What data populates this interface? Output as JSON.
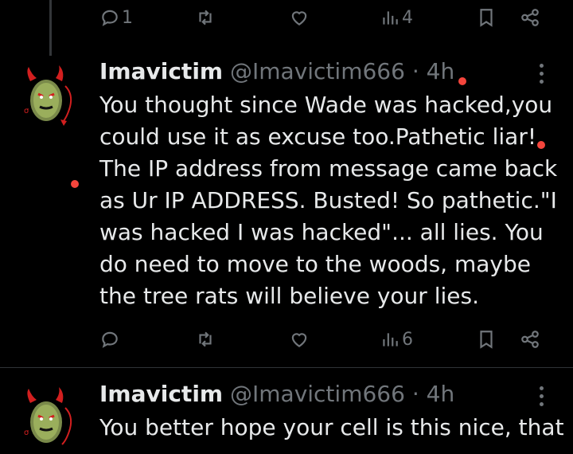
{
  "top_actions": {
    "reply_count": "1",
    "views_count": "4"
  },
  "tweet1": {
    "display_name": "Imavictim",
    "handle": "@Imavictim666",
    "separator": "·",
    "time": "4h",
    "text": "You thought since Wade was hacked,you could use it as excuse too.Pathetic liar! The IP address from message came back as Ur IP ADDRESS. Busted! So pathetic.\"I was hacked I was hacked\"... all lies. You do need to move to the woods, maybe the tree rats will believe your lies.",
    "actions": {
      "views_count": "6"
    }
  },
  "tweet2": {
    "display_name": "Imavictim",
    "handle": "@Imavictim666",
    "separator": "·",
    "time": "4h",
    "text": "You better hope your cell is this nice, that"
  },
  "colors": {
    "background": "#000000",
    "text": "#e7e9ea",
    "muted": "#71767b",
    "divider": "#2f3336",
    "marker": "#f4453c"
  },
  "icons": [
    "reply-icon",
    "retweet-icon",
    "like-icon",
    "views-icon",
    "bookmark-icon",
    "share-icon",
    "more-icon",
    "avatar-devil-pickle"
  ]
}
